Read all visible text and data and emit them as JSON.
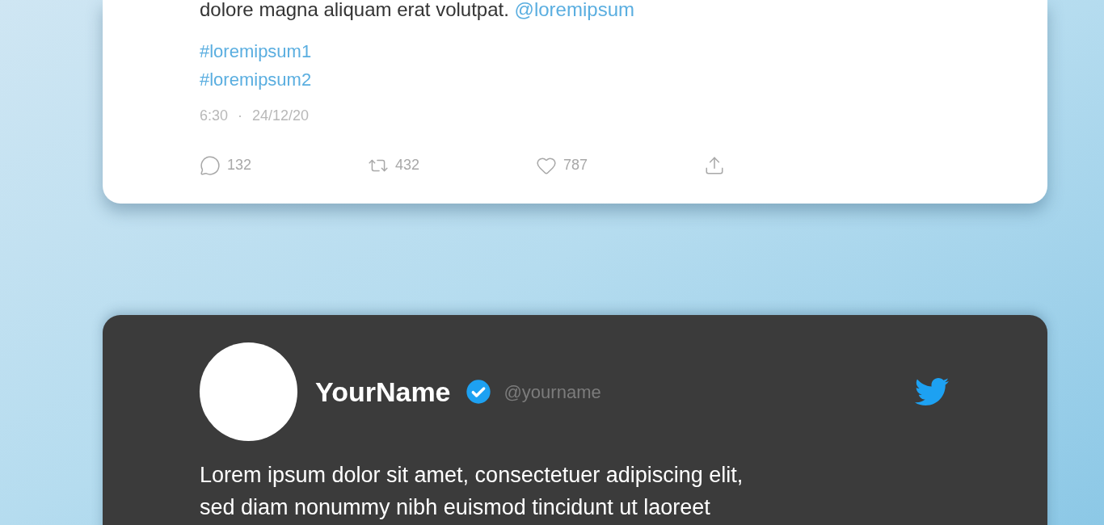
{
  "light_tweet": {
    "text": "dolore magna aliquam erat volutpat.",
    "mention": "@loremipsum",
    "hashtags": [
      "#loremipsum1",
      "#loremipsum2"
    ],
    "time": "6:30",
    "separator": "·",
    "date": "24/12/20",
    "actions": [
      {
        "kind": "reply",
        "count": "132"
      },
      {
        "kind": "retweet",
        "count": "432"
      },
      {
        "kind": "like",
        "count": "787"
      },
      {
        "kind": "share"
      }
    ]
  },
  "dark_tweet": {
    "name": "YourName",
    "verified": true,
    "handle": "@yourname",
    "lines": [
      "Lorem ipsum dolor sit amet, consectetuer adipiscing elit,",
      "sed diam nonummy nibh euismod tincidunt ut laoreet"
    ]
  }
}
